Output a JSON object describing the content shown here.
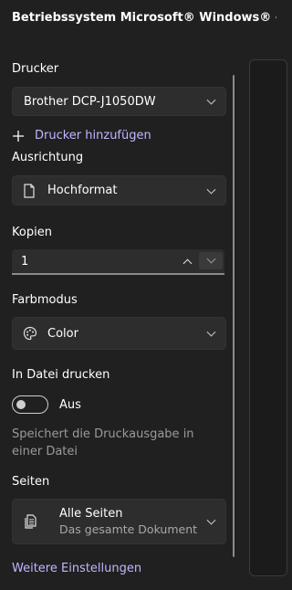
{
  "window": {
    "title": "Betriebssystem Microsoft® Windows® – Druc"
  },
  "printer": {
    "label": "Drucker",
    "value": "Brother DCP-J1050DW",
    "add_label": "Drucker hinzufügen"
  },
  "orientation": {
    "label": "Ausrichtung",
    "value": "Hochformat"
  },
  "copies": {
    "label": "Kopien",
    "value": "1"
  },
  "color_mode": {
    "label": "Farbmodus",
    "value": "Color"
  },
  "print_to_file": {
    "label": "In Datei drucken",
    "state_label": "Aus",
    "description": "Speichert die Druckausgabe in einer Datei"
  },
  "pages": {
    "label": "Seiten",
    "value": "Alle Seiten",
    "sub": "Das gesamte Dokument"
  },
  "more_settings": {
    "label": "Weitere Einstellungen"
  },
  "colors": {
    "background": "#202020",
    "control": "#2d2d2d",
    "link": "#c3b4ff"
  }
}
